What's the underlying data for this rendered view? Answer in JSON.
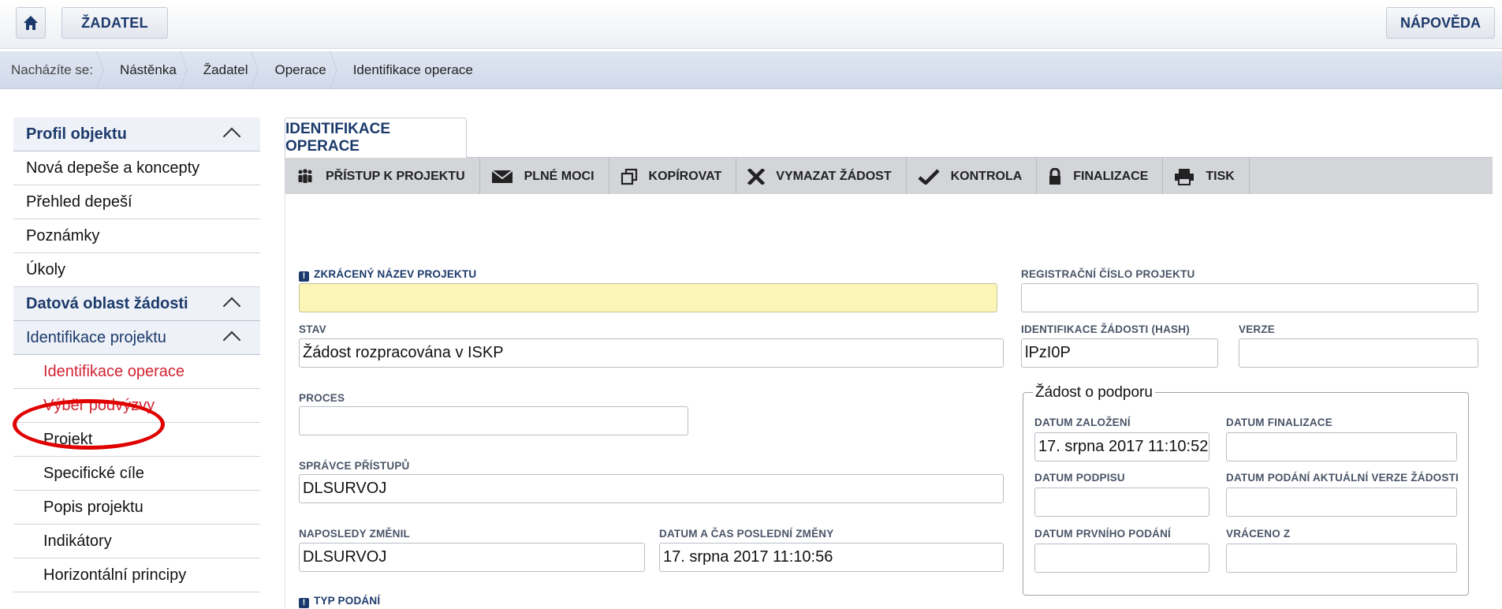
{
  "topbar": {
    "home_icon": "home-icon",
    "zadatel_label": "ŽADATEL",
    "help_label": "NÁPOVĚDA"
  },
  "breadcrumb": {
    "prefix": "Nacházíte se:",
    "items": [
      "Nástěnka",
      "Žadatel",
      "Operace",
      "Identifikace operace"
    ]
  },
  "sidebar": {
    "items": [
      {
        "label": "Profil objektu"
      },
      {
        "label": "Nová depeše a koncepty"
      },
      {
        "label": "Přehled depeší"
      },
      {
        "label": "Poznámky"
      },
      {
        "label": "Úkoly"
      },
      {
        "label": "Datová oblast žádosti"
      },
      {
        "label": "Identifikace projektu"
      },
      {
        "label": "Identifikace operace"
      },
      {
        "label": "Výběr podvýzvy"
      },
      {
        "label": "Projekt"
      },
      {
        "label": "Specifické cíle"
      },
      {
        "label": "Popis projektu"
      },
      {
        "label": "Indikátory"
      },
      {
        "label": "Horizontální principy"
      }
    ],
    "highlight_color": "#e00000"
  },
  "tab": {
    "label": "IDENTIFIKACE OPERACE"
  },
  "toolbar": {
    "items": [
      {
        "label": "PŘÍSTUP K PROJEKTU",
        "icon": "people-icon"
      },
      {
        "label": "PLNÉ MOCI",
        "icon": "envelope-icon"
      },
      {
        "label": "KOPÍROVAT",
        "icon": "copy-icon"
      },
      {
        "label": "VYMAZAT ŽÁDOST",
        "icon": "delete-icon"
      },
      {
        "label": "KONTROLA",
        "icon": "check-icon"
      },
      {
        "label": "FINALIZACE",
        "icon": "lock-icon"
      },
      {
        "label": "TISK",
        "icon": "print-icon"
      }
    ]
  },
  "form": {
    "zkraceny_nazev": {
      "label": "ZKRÁCENÝ NÁZEV PROJEKTU",
      "value": ""
    },
    "registracni_cislo": {
      "label": "REGISTRAČNÍ ČÍSLO PROJEKTU",
      "value": ""
    },
    "stav": {
      "label": "STAV",
      "value": "Žádost rozpracována v ISKP"
    },
    "identifikace_zadosti": {
      "label": "IDENTIFIKACE ŽÁDOSTI (HASH)",
      "value": "lPzI0P"
    },
    "verze": {
      "label": "VERZE",
      "value": ""
    },
    "proces": {
      "label": "PROCES",
      "value": ""
    },
    "spravce": {
      "label": "SPRÁVCE PŘÍSTUPŮ",
      "value": "DLSURVOJ"
    },
    "naposledy": {
      "label": "NAPOSLEDY ZMĚNIL",
      "value": "DLSURVOJ"
    },
    "datum_zmeny": {
      "label": "DATUM A ČAS POSLEDNÍ ZMĚNY",
      "value": "17. srpna 2017 11:10:56"
    },
    "typ_podani": {
      "label": "TYP PODÁNÍ"
    }
  },
  "zadost": {
    "legend": "Žádost o podporu",
    "datum_zalozeni": {
      "label": "DATUM ZALOŽENÍ",
      "value": "17. srpna 2017 11:10:52"
    },
    "datum_finalizace": {
      "label": "DATUM FINALIZACE",
      "value": ""
    },
    "datum_podpisu": {
      "label": "DATUM PODPISU",
      "value": ""
    },
    "datum_podani": {
      "label": "DATUM PODÁNÍ AKTUÁLNÍ VERZE ŽÁDOSTI",
      "value": ""
    },
    "datum_prvniho": {
      "label": "DATUM PRVNÍHO PODÁNÍ",
      "value": ""
    },
    "vraceno": {
      "label": "VRÁCENO Z",
      "value": ""
    }
  },
  "colors": {
    "accent": "#1b3a6b",
    "active_red": "#d12433",
    "required_bg": "#fbf6b6"
  }
}
